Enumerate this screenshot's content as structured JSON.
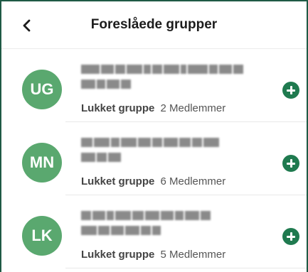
{
  "header": {
    "title": "Foreslåede grupper",
    "back_icon": "chevron-left-icon"
  },
  "groups": [
    {
      "initials": "UG",
      "type": "Lukket gruppe",
      "members": "2 Medlemmer",
      "avatar_color": "#5aa86f"
    },
    {
      "initials": "MN",
      "type": "Lukket gruppe",
      "members": "6 Medlemmer",
      "avatar_color": "#5aa86f"
    },
    {
      "initials": "LK",
      "type": "Lukket gruppe",
      "members": "5 Medlemmer",
      "avatar_color": "#5aa86f"
    }
  ],
  "colors": {
    "accent": "#1f7a4f",
    "avatar": "#5aa86f",
    "frame_border": "#1f5a45"
  },
  "icons": {
    "join": "plus-circle-icon"
  }
}
